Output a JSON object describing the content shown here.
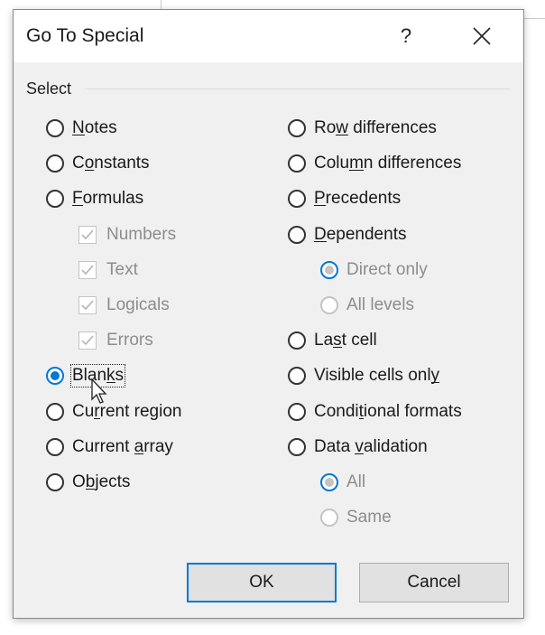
{
  "dialog": {
    "title": "Go To Special",
    "help_label": "?",
    "group_label": "Select",
    "left_options": [
      {
        "label": "Notes",
        "accel": "N",
        "selected": false
      },
      {
        "label": "Constants",
        "accel": "o",
        "selected": false
      },
      {
        "label": "Formulas",
        "accel": "F",
        "selected": false
      }
    ],
    "formula_checks": [
      {
        "label": "Numbers",
        "checked": true
      },
      {
        "label": "Text",
        "checked": true
      },
      {
        "label": "Logicals",
        "checked": true
      },
      {
        "label": "Errors",
        "checked": true
      }
    ],
    "left_options2": [
      {
        "label": "Blanks",
        "accel": "k",
        "selected": true
      },
      {
        "label": "Current region",
        "accel": "r",
        "selected": false
      },
      {
        "label": "Current array",
        "accel": "a",
        "selected": false
      },
      {
        "label": "Objects",
        "accel": "b",
        "selected": false
      }
    ],
    "right_options": [
      {
        "label": "Row differences",
        "accel": "w",
        "selected": false
      },
      {
        "label": "Column differences",
        "accel": "m",
        "selected": false
      },
      {
        "label": "Precedents",
        "accel": "P",
        "selected": false
      },
      {
        "label": "Dependents",
        "accel": "D",
        "selected": false
      }
    ],
    "dependents_sub": [
      {
        "label": "Direct only",
        "selected": true
      },
      {
        "label": "All levels",
        "selected": false
      }
    ],
    "right_options2": [
      {
        "label": "Last cell",
        "accel": "s",
        "selected": false
      },
      {
        "label": "Visible cells only",
        "accel": "y",
        "selected": false
      },
      {
        "label": "Conditional formats",
        "accel": "t",
        "selected": false
      },
      {
        "label": "Data validation",
        "accel": "v",
        "selected": false
      }
    ],
    "validation_sub": [
      {
        "label": "All",
        "selected": true
      },
      {
        "label": "Same",
        "selected": false
      }
    ],
    "ok_label": "OK",
    "cancel_label": "Cancel"
  }
}
